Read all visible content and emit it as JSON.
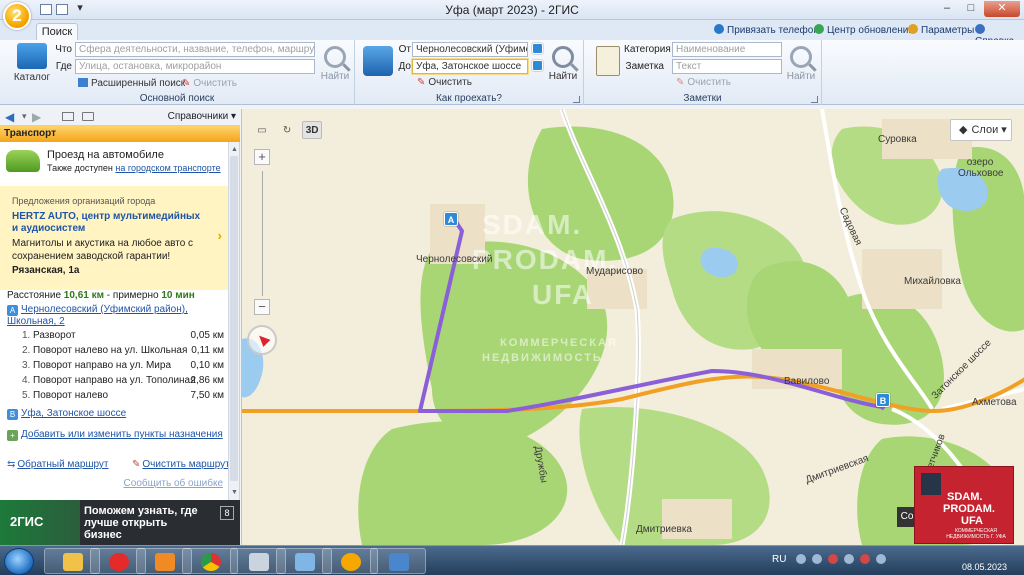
{
  "window": {
    "title": "Уфа (март 2023) - 2ГИС",
    "app_logo": "2",
    "buttons": [
      "–",
      "□",
      "✕"
    ]
  },
  "ribbon": {
    "tab": "Поиск",
    "links": {
      "attach_phone": "Привязать телефон",
      "updates": "Центр обновлений",
      "settings": "Параметры",
      "help": "Справка"
    },
    "main_search": {
      "catalog_label": "Каталог",
      "what_label": "Что",
      "what_placeholder": "Сфера деятельности, название, телефон, маршрут",
      "where_label": "Где",
      "where_placeholder": "Улица, остановка, микрорайон",
      "find_label": "Найти",
      "advanced_label": "Расширенный поиск",
      "clear_label": "Очистить",
      "caption": "Основной поиск"
    },
    "route": {
      "from_label": "От",
      "from_value": "Чернолесовский (Уфимский р",
      "to_label": "До",
      "to_value": "Уфа, Затонское шоссе",
      "find_label": "Найти",
      "clear_label": "Очистить",
      "caption": "Как проехать?"
    },
    "notes": {
      "category_label": "Категория",
      "category_placeholder": "Наименование",
      "note_label": "Заметка",
      "note_placeholder": "Текст",
      "find_label": "Найти",
      "clear_label": "Очистить",
      "caption": "Заметки"
    }
  },
  "left_panel": {
    "directories_label": "Справочники",
    "section_title": "Транспорт",
    "mode_title": "Проезд на автомобиле",
    "mode_also": "Также доступен",
    "mode_also_link": "на городском транспорте",
    "promo_heading": "Предложения организаций города",
    "promo_company": "HERTZ AUTO, центр мультимедийных и аудиосистем",
    "promo_text": "Магнитолы и акустика на любое авто с сохранением заводской гарантии!",
    "promo_address": "Рязанская, 1а",
    "distance_prefix": "Расстояние",
    "distance_value": "10,61 км",
    "distance_mid": "- примерно",
    "duration_value": "10 мин",
    "start_point": "Чернолесовский (Уфимский район), Школьная, 2",
    "end_point": "Уфа, Затонское шоссе",
    "steps": [
      {
        "n": "1.",
        "text": "Разворот",
        "dist": "0,05 км"
      },
      {
        "n": "2.",
        "text": "Поворот налево на ул. Школьная",
        "dist": "0,11 км"
      },
      {
        "n": "3.",
        "text": "Поворот направо на ул. Мира",
        "dist": "0,10 км"
      },
      {
        "n": "4.",
        "text": "Поворот направо на ул. Тополиная",
        "dist": "2,86 км"
      },
      {
        "n": "5.",
        "text": "Поворот налево",
        "dist": "7,50 км"
      }
    ],
    "add_points_link": "Добавить или изменить пункты назначения",
    "reverse_link": "Обратный маршрут",
    "clear_route_link": "Очистить маршрут",
    "report_error_link": "Сообщить об ошибке",
    "banner_logo": "2ГИС",
    "banner_text": "Поможем узнать, где лучше открыть бизнес",
    "banner_counter": "8"
  },
  "map": {
    "view_3d": "3D",
    "layers_label": "Слои",
    "labels": {
      "chernolesovsky": "Чернолесовский",
      "mudarisovo": "Мударисово",
      "vavilovo": "Вавилово",
      "mikhailovka": "Михайловка",
      "surovka": "Суровка",
      "lake": "озеро Ольховое",
      "sadovaya": "Садовая",
      "zatonskoe": "Затонское шоссе",
      "akhmetovo": "Ахметова",
      "druzhby": "Дружбы",
      "dmitrievskaya": "Дмитриевская",
      "dmitrievka": "Дмитриевка",
      "letchikov": "Летчиков"
    },
    "pin_a": "A",
    "pin_b": "B",
    "watermark": [
      "SDAM.",
      "PRODAM.",
      "UFA",
      "КОММЕРЧЕСКАЯ",
      "НЕДВИЖИМОСТЬ"
    ],
    "badge_lines": [
      "SDAM.",
      "PRODAM.",
      "UFA",
      "КОММЕРЧЕСКАЯ НЕДВИЖИМОСТЬ Г. УФА"
    ],
    "corner_label": "Co"
  },
  "taskbar": {
    "lang": "RU",
    "date": "08.05.2023"
  }
}
